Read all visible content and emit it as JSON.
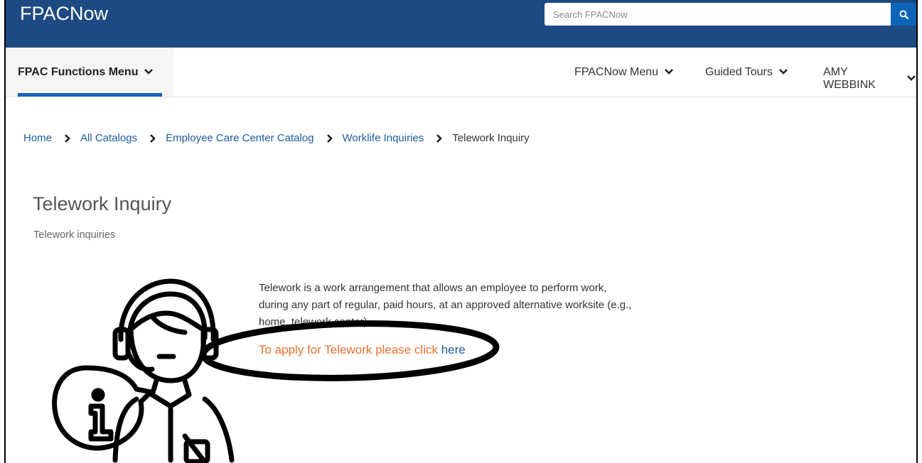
{
  "header": {
    "brand": "FPACNow",
    "search_placeholder": "Search FPACNow"
  },
  "nav": {
    "functions_menu": "FPAC Functions Menu",
    "fpacnow_menu": "FPACNow Menu",
    "guided_tours": "Guided Tours",
    "user": "AMY WEBBINK"
  },
  "breadcrumb": {
    "items": [
      "Home",
      "All Catalogs",
      "Employee Care Center Catalog",
      "Worklife Inquiries"
    ],
    "current": "Telework Inquiry"
  },
  "page": {
    "title": "Telework Inquiry",
    "subtitle": "Telework inquiries",
    "description_line1": "Telework is a work arrangement that allows an employee to perform work,",
    "description_line2": "during any part of regular, paid hours, at an approved alternative worksite (e.g.,",
    "description_line3": "home, telework center).",
    "apply_text": "To apply for Telework please click ",
    "apply_link": "here"
  },
  "colors": {
    "topbar": "#1d4a82",
    "accent": "#1664b7",
    "link": "#1e5d9e",
    "apply": "#e8702a"
  }
}
